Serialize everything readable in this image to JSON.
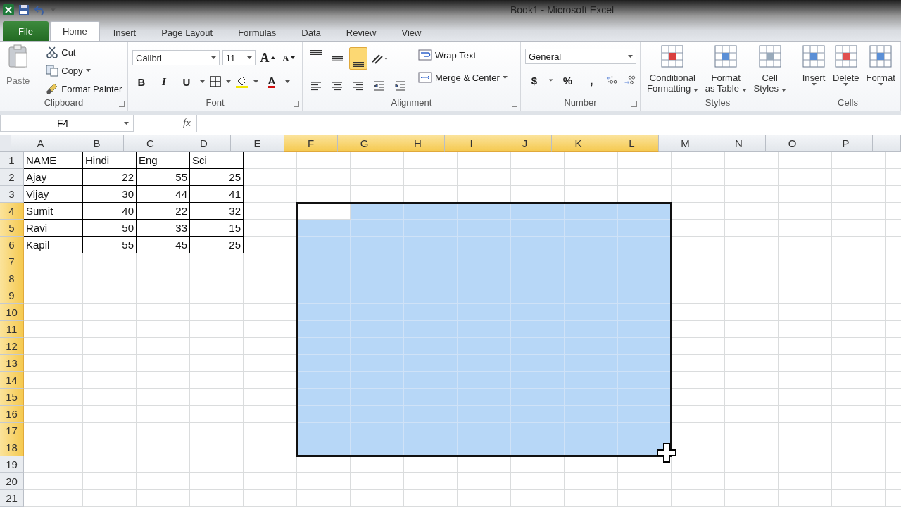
{
  "window": {
    "title": "Book1  -  Microsoft Excel"
  },
  "tabs": [
    {
      "label": "File",
      "kind": "file",
      "selected": false
    },
    {
      "label": "Home",
      "kind": "tab",
      "selected": true
    },
    {
      "label": "Insert",
      "kind": "tab",
      "selected": false
    },
    {
      "label": "Page Layout",
      "kind": "tab",
      "selected": false
    },
    {
      "label": "Formulas",
      "kind": "tab",
      "selected": false
    },
    {
      "label": "Data",
      "kind": "tab",
      "selected": false
    },
    {
      "label": "Review",
      "kind": "tab",
      "selected": false
    },
    {
      "label": "View",
      "kind": "tab",
      "selected": false
    }
  ],
  "ribbon": {
    "clipboard": {
      "label": "Clipboard",
      "paste": "Paste",
      "cut": "Cut",
      "copy": "Copy",
      "format_painter": "Format Painter"
    },
    "font": {
      "label": "Font",
      "font_name": "Calibri",
      "font_size": "11",
      "grow": "A",
      "shrink": "A",
      "bold": "B",
      "italic": "I",
      "underline": "U",
      "font_color": "A"
    },
    "alignment": {
      "label": "Alignment",
      "wrap_text": "Wrap Text",
      "merge": "Merge & Center",
      "align_buttons": [
        {
          "kind": "top",
          "selected": false
        },
        {
          "kind": "middle",
          "selected": false
        },
        {
          "kind": "bottom",
          "selected": true
        }
      ]
    },
    "number": {
      "label": "Number",
      "format": "General",
      "currency": "$",
      "percent": "%",
      "comma": ","
    },
    "styles": {
      "label": "Styles",
      "buttons": [
        {
          "kind": "conditional",
          "lines": [
            "Conditional",
            "Formatting"
          ]
        },
        {
          "kind": "table",
          "lines": [
            "Format",
            "as Table"
          ]
        },
        {
          "kind": "cellstyles",
          "lines": [
            "Cell",
            "Styles"
          ]
        }
      ]
    },
    "cells": {
      "label": "Cells",
      "buttons": [
        {
          "kind": "insert",
          "label": "Insert"
        },
        {
          "kind": "delete",
          "label": "Delete"
        },
        {
          "kind": "format",
          "label": "Format"
        }
      ]
    }
  },
  "formula_bar": {
    "name_box": "F4",
    "fx": "fx"
  },
  "sheet": {
    "columns": [
      {
        "label": "A",
        "selected": false
      },
      {
        "label": "B",
        "selected": false
      },
      {
        "label": "C",
        "selected": false
      },
      {
        "label": "D",
        "selected": false
      },
      {
        "label": "E",
        "selected": false
      },
      {
        "label": "F",
        "selected": true
      },
      {
        "label": "G",
        "selected": true
      },
      {
        "label": "H",
        "selected": true
      },
      {
        "label": "I",
        "selected": true
      },
      {
        "label": "J",
        "selected": true
      },
      {
        "label": "K",
        "selected": true
      },
      {
        "label": "L",
        "selected": true
      },
      {
        "label": "M",
        "selected": false
      },
      {
        "label": "N",
        "selected": false
      },
      {
        "label": "O",
        "selected": false
      },
      {
        "label": "P",
        "selected": false
      }
    ],
    "rows": [
      {
        "label": "1",
        "selected": false,
        "kind": "header",
        "cells": [
          "NAME",
          "Hindi",
          "Eng",
          "Sci"
        ]
      },
      {
        "label": "2",
        "selected": false,
        "kind": "data",
        "cells": [
          "Ajay",
          "22",
          "55",
          "25"
        ]
      },
      {
        "label": "3",
        "selected": false,
        "kind": "data",
        "cells": [
          "Vijay",
          "30",
          "44",
          "41"
        ]
      },
      {
        "label": "4",
        "selected": true,
        "kind": "data",
        "cells": [
          "Sumit",
          "40",
          "22",
          "32"
        ]
      },
      {
        "label": "5",
        "selected": true,
        "kind": "data",
        "cells": [
          "Ravi",
          "50",
          "33",
          "15"
        ]
      },
      {
        "label": "6",
        "selected": true,
        "kind": "data",
        "cells": [
          "Kapil",
          "55",
          "45",
          "25"
        ]
      },
      {
        "label": "7",
        "selected": true,
        "kind": "data",
        "cells": []
      },
      {
        "label": "8",
        "selected": true,
        "kind": "data",
        "cells": []
      },
      {
        "label": "9",
        "selected": true,
        "kind": "data",
        "cells": []
      },
      {
        "label": "10",
        "selected": true,
        "kind": "data",
        "cells": []
      },
      {
        "label": "11",
        "selected": true,
        "kind": "data",
        "cells": []
      },
      {
        "label": "12",
        "selected": true,
        "kind": "data",
        "cells": []
      },
      {
        "label": "13",
        "selected": true,
        "kind": "data",
        "cells": []
      },
      {
        "label": "14",
        "selected": true,
        "kind": "data",
        "cells": []
      },
      {
        "label": "15",
        "selected": true,
        "kind": "data",
        "cells": []
      },
      {
        "label": "16",
        "selected": true,
        "kind": "data",
        "cells": []
      },
      {
        "label": "17",
        "selected": true,
        "kind": "data",
        "cells": []
      },
      {
        "label": "18",
        "selected": true,
        "kind": "data",
        "cells": []
      },
      {
        "label": "19",
        "selected": false,
        "kind": "data",
        "cells": []
      },
      {
        "label": "20",
        "selected": false,
        "kind": "data",
        "cells": []
      },
      {
        "label": "21",
        "selected": false,
        "kind": "data",
        "cells": []
      }
    ]
  }
}
